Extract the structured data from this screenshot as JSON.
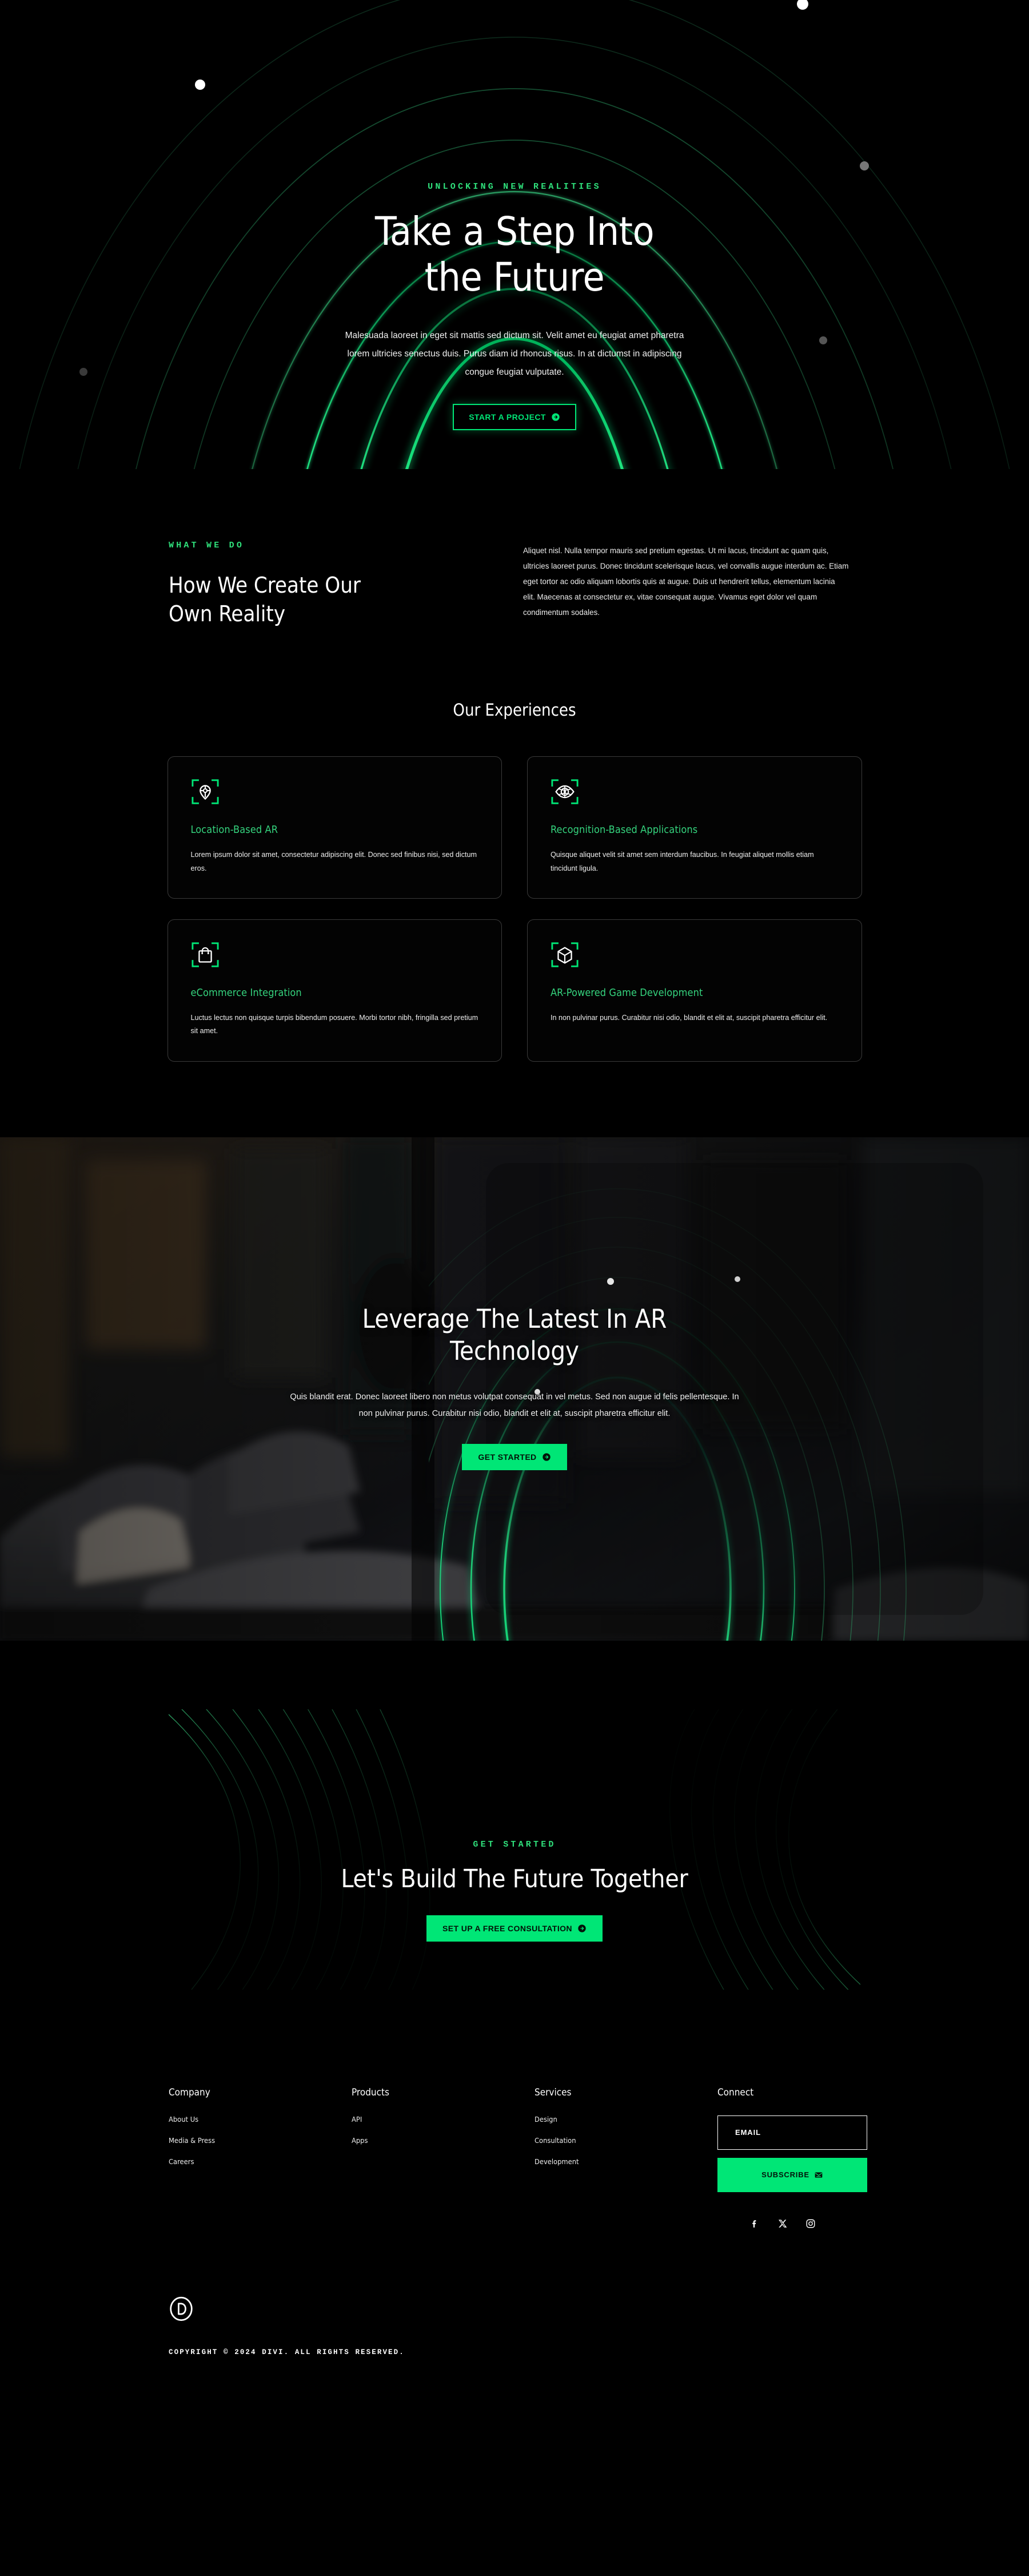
{
  "theme": {
    "accent": "#00E676",
    "accent_soft": "#35D47E",
    "bg": "#000000",
    "card_border": "#3A3A3A",
    "text": "#FFFFFF"
  },
  "hero": {
    "eyebrow": "UNLOCKING NEW REALITIES",
    "title_line1": "Take a Step Into",
    "title_line2": "the Future",
    "paragraph": "Malesuada laoreet in eget sit mattis sed dictum sit. Velit amet eu feugiat amet pharetra lorem ultricies senectus duis. Purus diam id rhoncus risus. In at dictumst in adipiscing congue feugiat vulputate.",
    "cta_label": "START A PROJECT",
    "cta_icon": "arrow-circle-right-icon"
  },
  "what_we_do": {
    "eyebrow": "WHAT WE DO",
    "heading_line1": "How We Create Our",
    "heading_line2": "Own Reality",
    "paragraph": "Aliquet nisl. Nulla tempor mauris sed pretium egestas. Ut mi lacus, tincidunt ac quam quis, ultricies laoreet purus. Donec tincidunt scelerisque lacus, vel convallis augue interdum ac. Etiam eget tortor ac odio aliquam lobortis quis at augue. Duis ut hendrerit tellus, elementum lacinia elit. Maecenas at consectetur ex, vitae consequat augue. Vivamus eget dolor vel quam condimentum sodales."
  },
  "experiences": {
    "title": "Our Experiences",
    "cards": [
      {
        "icon": "location-pin-scan-icon",
        "title": "Location-Based AR",
        "text": "Lorem ipsum dolor sit amet, consectetur adipiscing elit. Donec sed finibus nisi, sed dictum eros."
      },
      {
        "icon": "eye-scan-icon",
        "title": "Recognition-Based Applications",
        "text": "Quisque aliquet velit sit amet sem interdum faucibus. In feugiat aliquet mollis etiam tincidunt ligula."
      },
      {
        "icon": "shopping-bag-scan-icon",
        "title": "eCommerce Integration",
        "text": "Luctus lectus non quisque turpis bibendum posuere. Morbi tortor nibh, fringilla sed pretium sit amet."
      },
      {
        "icon": "cube-scan-icon",
        "title": "AR-Powered Game Development",
        "text": "In non pulvinar purus. Curabitur nisi odio, blandit et elit at, suscipit pharetra efficitur elit."
      }
    ]
  },
  "ar_tech": {
    "title_line1": "Leverage The Latest In AR",
    "title_line2": "Technology",
    "paragraph": "Quis blandit erat. Donec laoreet libero non metus volutpat consequat in vel metus. Sed non augue id felis pellentesque. In non pulvinar purus. Curabitur nisi odio, blandit et elit at, suscipit pharetra efficitur elit.",
    "cta_label": "GET STARTED",
    "cta_icon": "arrow-circle-right-icon"
  },
  "cta": {
    "eyebrow": "GET STARTED",
    "heading": "Let's Build The Future Together",
    "button_label": "SET UP A FREE CONSULTATION",
    "button_icon": "arrow-circle-right-icon"
  },
  "footer": {
    "columns": [
      {
        "heading": "Company",
        "links": [
          "About Us",
          "Media & Press",
          "Careers"
        ]
      },
      {
        "heading": "Products",
        "links": [
          "API",
          "Apps"
        ]
      },
      {
        "heading": "Services",
        "links": [
          "Design",
          "Consultation",
          "Development"
        ]
      }
    ],
    "connect": {
      "heading": "Connect",
      "email_placeholder": "EMAIL",
      "email_value": "",
      "subscribe_label": "SUBSCRIBE",
      "subscribe_icon": "envelope-icon",
      "socials": [
        "facebook-icon",
        "x-twitter-icon",
        "instagram-icon"
      ]
    },
    "logo": "divi-d-logo",
    "copyright": "COPYRIGHT © 2024 DIVI. ALL RIGHTS RESERVED."
  }
}
